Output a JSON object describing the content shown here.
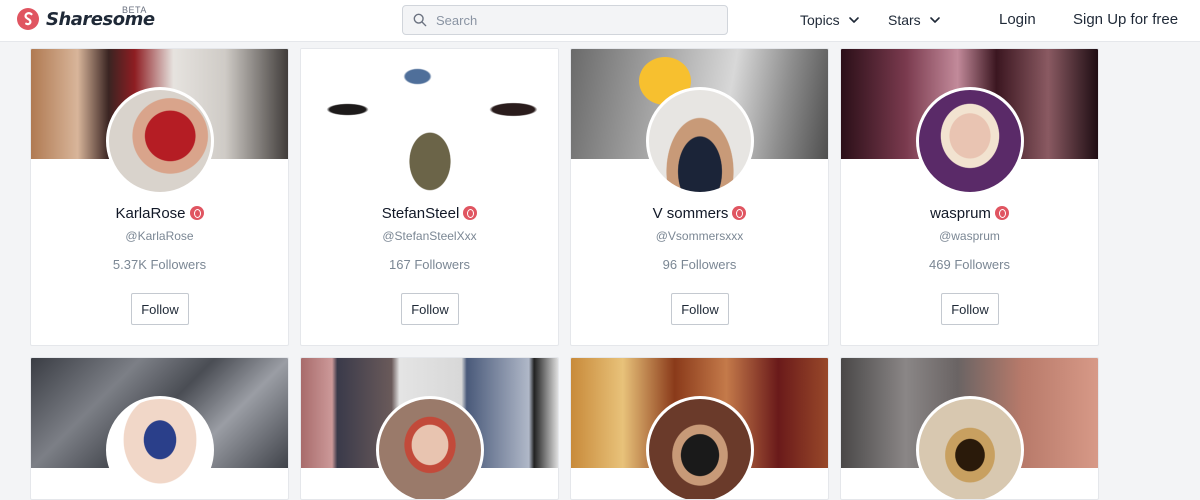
{
  "header": {
    "brand": "Sharesome",
    "beta": "BETA",
    "search_placeholder": "Search",
    "nav": [
      {
        "label": "Topics"
      },
      {
        "label": "Stars"
      }
    ],
    "login": "Login",
    "signup": "Sign Up for free"
  },
  "colors": {
    "brand": "#e05561",
    "text": "#1f2937",
    "muted": "#7b8794",
    "background": "#f3f4f6"
  },
  "profiles": [
    {
      "name": "KarlaRose",
      "handle": "@KarlaRose",
      "followers": "5.37K Followers",
      "follow_label": "Follow",
      "verified": true
    },
    {
      "name": "StefanSteel",
      "handle": "@StefanSteelXxx",
      "followers": "167 Followers",
      "follow_label": "Follow",
      "verified": true
    },
    {
      "name": "V sommers",
      "handle": "@Vsommersxxx",
      "followers": "96 Followers",
      "follow_label": "Follow",
      "verified": true
    },
    {
      "name": "wasprum",
      "handle": "@wasprum",
      "followers": "469 Followers",
      "follow_label": "Follow",
      "verified": true
    }
  ]
}
